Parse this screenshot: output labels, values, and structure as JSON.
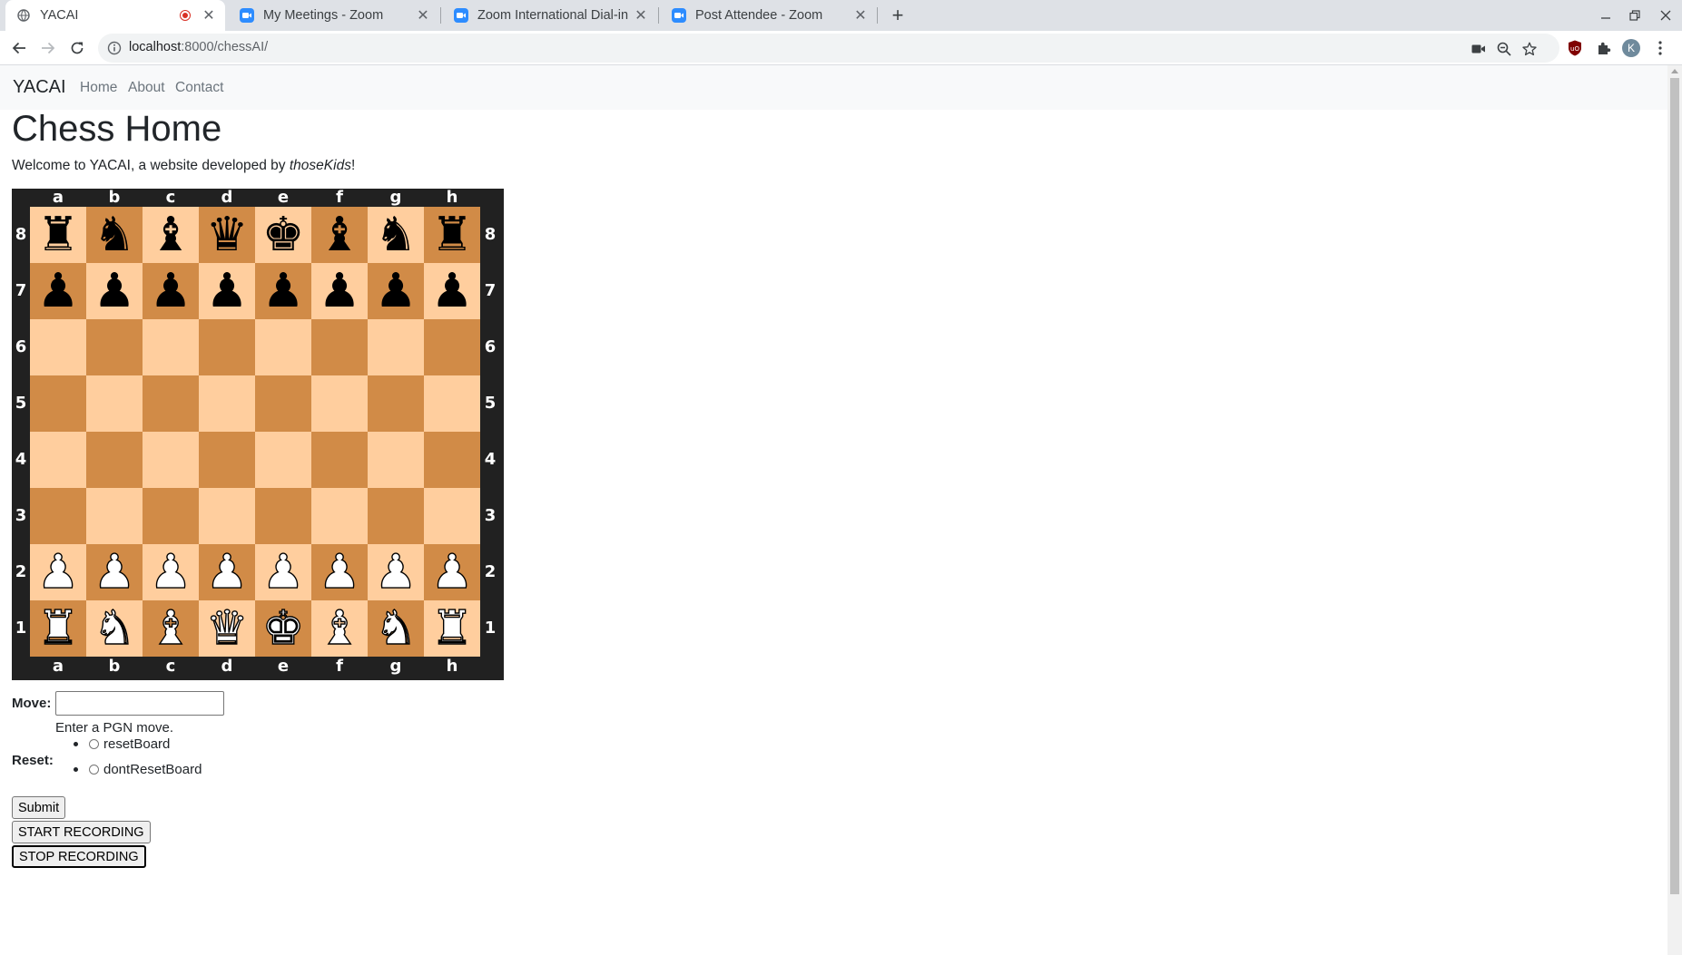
{
  "browser": {
    "tabs": [
      {
        "title": "YACAI",
        "icon": "globe-icon",
        "active": true,
        "recording": true
      },
      {
        "title": "My Meetings - Zoom",
        "icon": "zoom-icon"
      },
      {
        "title": "Zoom International Dial-in",
        "icon": "zoom-icon"
      },
      {
        "title": "Post Attendee - Zoom",
        "icon": "zoom-icon"
      }
    ],
    "new_tab": "+",
    "url_host": "localhost",
    "url_rest": ":8000/chessAI/",
    "profile_initial": "K"
  },
  "navbar": {
    "brand": "YACAI",
    "links": [
      "Home",
      "About",
      "Contact"
    ]
  },
  "page": {
    "title": "Chess Home",
    "welcome_prefix": "Welcome to YACAI, a website developed by ",
    "welcome_author": "thoseKids",
    "welcome_suffix": "!"
  },
  "board": {
    "files": [
      "a",
      "b",
      "c",
      "d",
      "e",
      "f",
      "g",
      "h"
    ],
    "ranks": [
      "8",
      "7",
      "6",
      "5",
      "4",
      "3",
      "2",
      "1"
    ],
    "position": [
      [
        "r",
        "n",
        "b",
        "q",
        "k",
        "b",
        "n",
        "r"
      ],
      [
        "p",
        "p",
        "p",
        "p",
        "p",
        "p",
        "p",
        "p"
      ],
      [
        "",
        "",
        "",
        "",
        "",
        "",
        "",
        ""
      ],
      [
        "",
        "",
        "",
        "",
        "",
        "",
        "",
        ""
      ],
      [
        "",
        "",
        "",
        "",
        "",
        "",
        "",
        ""
      ],
      [
        "",
        "",
        "",
        "",
        "",
        "",
        "",
        ""
      ],
      [
        "P",
        "P",
        "P",
        "P",
        "P",
        "P",
        "P",
        "P"
      ],
      [
        "R",
        "N",
        "B",
        "Q",
        "K",
        "B",
        "N",
        "R"
      ]
    ],
    "light_color": "#ffce9e",
    "dark_color": "#d18b47",
    "frame_color": "#212121"
  },
  "form": {
    "move_label": "Move:",
    "move_value": "",
    "move_hint": "Enter a PGN move.",
    "reset_label": "Reset:",
    "reset_options": [
      "resetBoard",
      "dontResetBoard"
    ],
    "submit_label": "Submit",
    "start_recording_label": "START RECORDING",
    "stop_recording_label": "STOP RECORDING"
  }
}
